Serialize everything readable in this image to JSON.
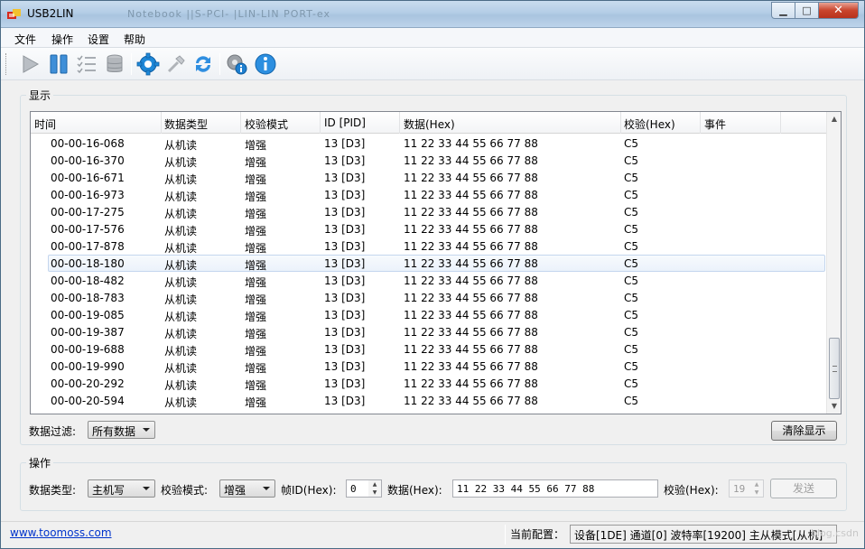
{
  "window": {
    "title": "USB2LIN",
    "title_blur": "Notebook  ||S-PCI-  |LIN-LIN  PORT-ex",
    "min_glyph": "▁",
    "max_glyph": "□",
    "close_glyph": "✕"
  },
  "menu": [
    "文件",
    "操作",
    "设置",
    "帮助"
  ],
  "toolbar": {
    "icons": [
      "play-icon",
      "pause-icon",
      "checklist-icon",
      "database-icon",
      "settings-gear-icon",
      "tools-icon",
      "refresh-icon",
      "device-info-icon",
      "help-info-icon"
    ]
  },
  "display": {
    "group_label": "显示",
    "columns": [
      "时间",
      "数据类型",
      "校验模式",
      "ID [PID]",
      "数据(Hex)",
      "校验(Hex)",
      "事件"
    ],
    "rows": [
      [
        "00-00-16-068",
        "从机读",
        "增强",
        "13 [D3]",
        "11 22 33 44 55 66 77 88",
        "C5",
        ""
      ],
      [
        "00-00-16-370",
        "从机读",
        "增强",
        "13 [D3]",
        "11 22 33 44 55 66 77 88",
        "C5",
        ""
      ],
      [
        "00-00-16-671",
        "从机读",
        "增强",
        "13 [D3]",
        "11 22 33 44 55 66 77 88",
        "C5",
        ""
      ],
      [
        "00-00-16-973",
        "从机读",
        "增强",
        "13 [D3]",
        "11 22 33 44 55 66 77 88",
        "C5",
        ""
      ],
      [
        "00-00-17-275",
        "从机读",
        "增强",
        "13 [D3]",
        "11 22 33 44 55 66 77 88",
        "C5",
        ""
      ],
      [
        "00-00-17-576",
        "从机读",
        "增强",
        "13 [D3]",
        "11 22 33 44 55 66 77 88",
        "C5",
        ""
      ],
      [
        "00-00-17-878",
        "从机读",
        "增强",
        "13 [D3]",
        "11 22 33 44 55 66 77 88",
        "C5",
        ""
      ],
      [
        "00-00-18-180",
        "从机读",
        "增强",
        "13 [D3]",
        "11 22 33 44 55 66 77 88",
        "C5",
        ""
      ],
      [
        "00-00-18-482",
        "从机读",
        "增强",
        "13 [D3]",
        "11 22 33 44 55 66 77 88",
        "C5",
        ""
      ],
      [
        "00-00-18-783",
        "从机读",
        "增强",
        "13 [D3]",
        "11 22 33 44 55 66 77 88",
        "C5",
        ""
      ],
      [
        "00-00-19-085",
        "从机读",
        "增强",
        "13 [D3]",
        "11 22 33 44 55 66 77 88",
        "C5",
        ""
      ],
      [
        "00-00-19-387",
        "从机读",
        "增强",
        "13 [D3]",
        "11 22 33 44 55 66 77 88",
        "C5",
        ""
      ],
      [
        "00-00-19-688",
        "从机读",
        "增强",
        "13 [D3]",
        "11 22 33 44 55 66 77 88",
        "C5",
        ""
      ],
      [
        "00-00-19-990",
        "从机读",
        "增强",
        "13 [D3]",
        "11 22 33 44 55 66 77 88",
        "C5",
        ""
      ],
      [
        "00-00-20-292",
        "从机读",
        "增强",
        "13 [D3]",
        "11 22 33 44 55 66 77 88",
        "C5",
        ""
      ],
      [
        "00-00-20-594",
        "从机读",
        "增强",
        "13 [D3]",
        "11 22 33 44 55 66 77 88",
        "C5",
        ""
      ]
    ],
    "selected_row": 7,
    "filter_label": "数据过滤:",
    "filter_value": "所有数据",
    "clear_button": "清除显示",
    "scroll_up": "▲",
    "scroll_down": "▼"
  },
  "operation": {
    "group_label": "操作",
    "data_type_label": "数据类型:",
    "data_type_value": "主机写",
    "check_mode_label": "校验模式:",
    "check_mode_value": "增强",
    "frame_id_label": "帧ID(Hex):",
    "frame_id_value": "0",
    "data_label": "数据(Hex):",
    "data_value": "11 22 33 44 55 66 77 88",
    "checksum_label": "校验(Hex):",
    "checksum_value": "19",
    "send_button": "发送",
    "spin_up": "▲",
    "spin_down": "▼"
  },
  "status": {
    "link": "www.toomoss.com",
    "config_label": "当前配置：",
    "config_value": "设备[1DE] 通道[0] 波特率[19200] 主从模式[从机]",
    "watermark": "blog.csdn"
  }
}
